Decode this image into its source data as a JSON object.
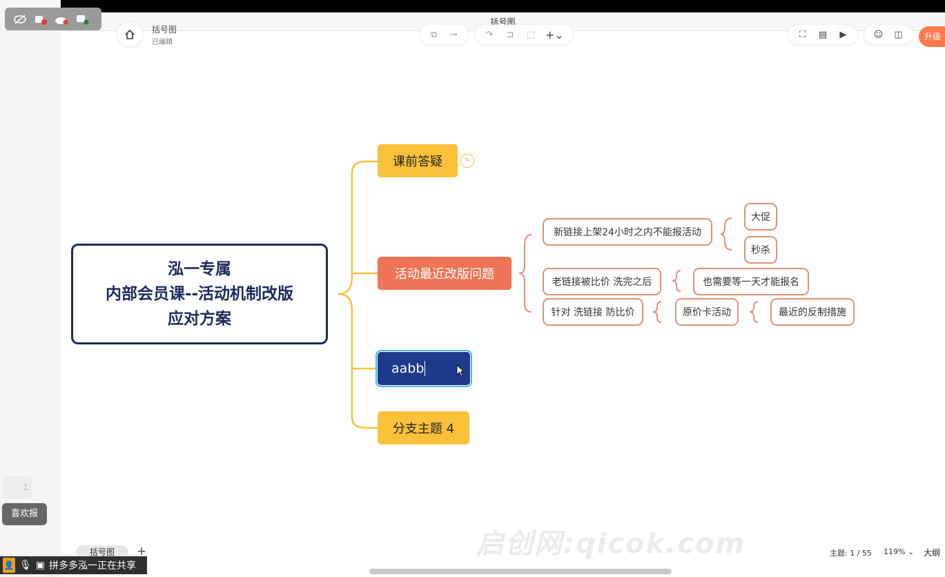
{
  "window": {
    "title": "括号图"
  },
  "share_controls": {
    "icons": [
      "eye-off-icon",
      "no-video-icon",
      "cloud-icon",
      "share-screen-icon"
    ]
  },
  "header": {
    "doc_name": "括号图",
    "doc_status": "已编辑",
    "upgrade_label": "升级"
  },
  "map": {
    "central": {
      "line1": "泓一专属",
      "line2": "内部会员课--活动机制改版",
      "line3": "应对方案"
    },
    "branches": {
      "b1": "课前答疑",
      "b2": "活动最近改版问题",
      "b3": "aabb",
      "b4": "分支主题 4"
    },
    "subtopics": {
      "s1": "新链接上架24小时之内不能报活动",
      "s1a": "大促",
      "s1b": "秒杀",
      "s2": "老链接被比价 洗完之后",
      "s2a": "也需要等一天才能报名",
      "s3": "针对 洗链接 防比价",
      "s3a": "原价卡活动",
      "s3b": "最近的反制措施"
    }
  },
  "footer": {
    "sheet_tab": "括号图",
    "add_sheet": "+",
    "topic_count": "主题: 1 / 55",
    "zoom": "119%",
    "outline": "大纲"
  },
  "overlay": {
    "sharer": "拼多多泓一正在共享",
    "like_count": "1",
    "xihuan": "喜欢报",
    "watermark": "启创网:qicok.com"
  },
  "colors": {
    "central_border": "#1b2a5c",
    "branch_yellow": "#fbc13a",
    "branch_orange": "#f07457",
    "selected_navy": "#1e3a8a",
    "sub_border": "#e09078",
    "upgrade": "#ff7a4d"
  }
}
